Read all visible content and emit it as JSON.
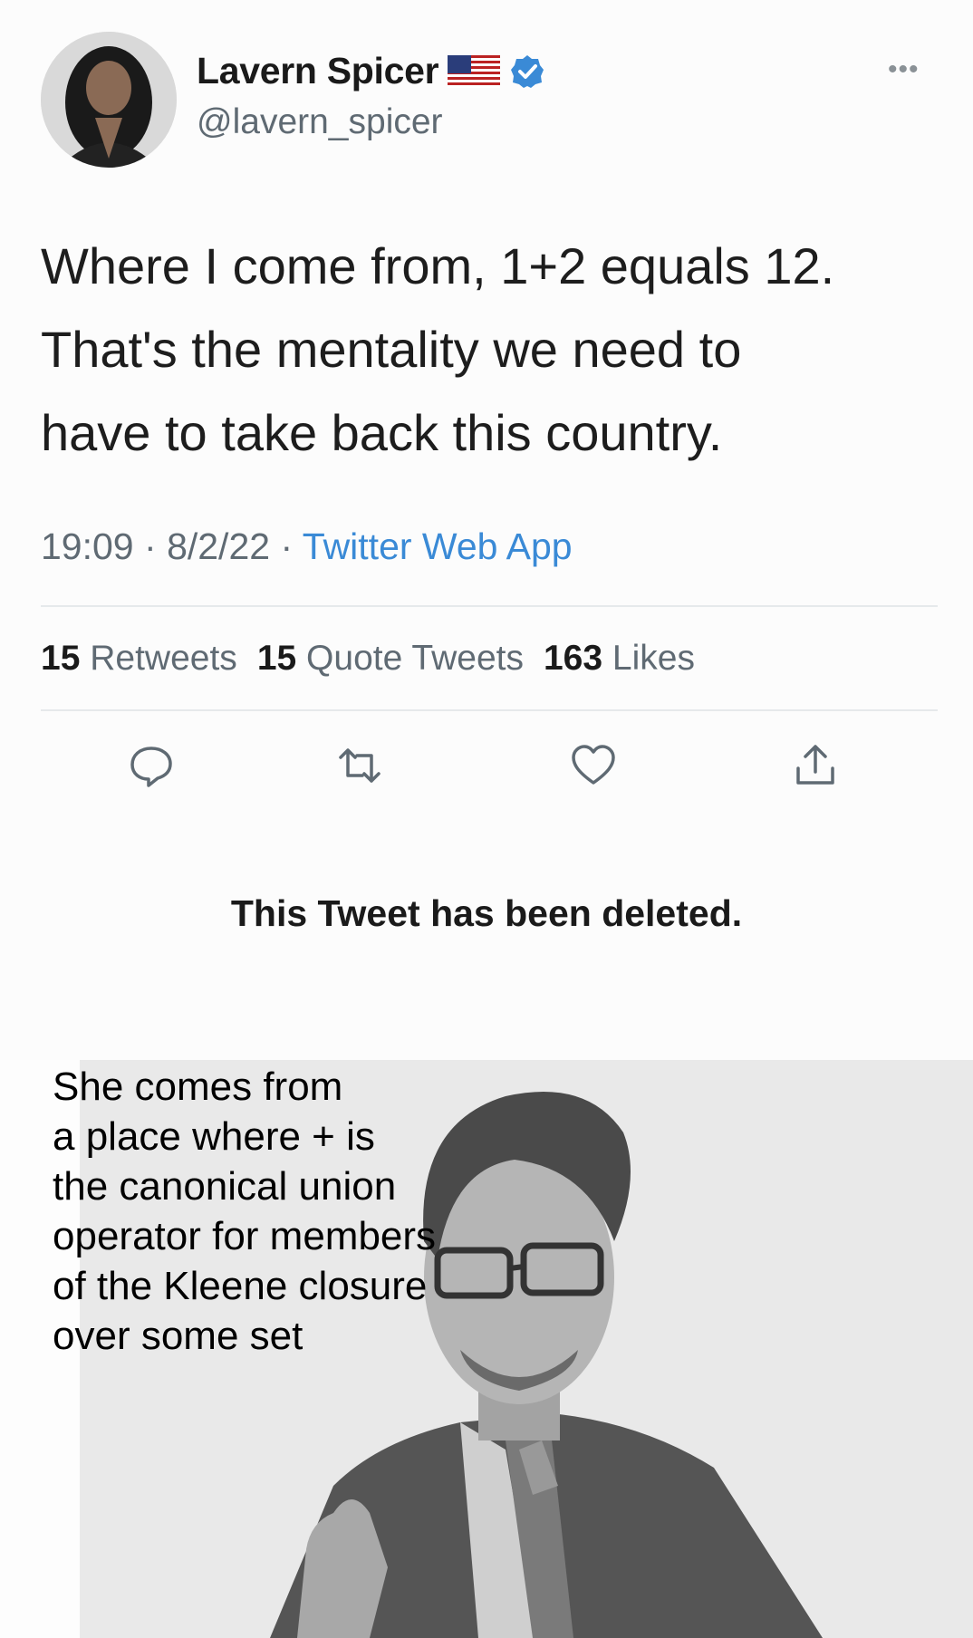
{
  "tweet": {
    "author_name": "Lavern Spicer",
    "handle": "@lavern_spicer",
    "more_icon": "more-dots-icon",
    "text_lines": [
      "Where I come from, 1+2 equals 12.",
      "That's the mentality we need to",
      "have to take back this country."
    ],
    "time": "19:09",
    "date": "8/2/22",
    "source": "Twitter Web App",
    "stats": {
      "retweets_count": "15",
      "retweets_label": "Retweets",
      "quotes_count": "15",
      "quotes_label": "Quote Tweets",
      "likes_count": "163",
      "likes_label": "Likes"
    },
    "deleted_notice": "This Tweet has been deleted.",
    "colors": {
      "link": "#3a8ad6",
      "verified": "#3a8ad6",
      "muted": "#5f6a73"
    }
  },
  "meme": {
    "caption_lines": [
      "She comes from",
      "a place where + is",
      "the canonical union",
      "operator for members",
      "of the Kleene closure",
      "over some set"
    ]
  }
}
